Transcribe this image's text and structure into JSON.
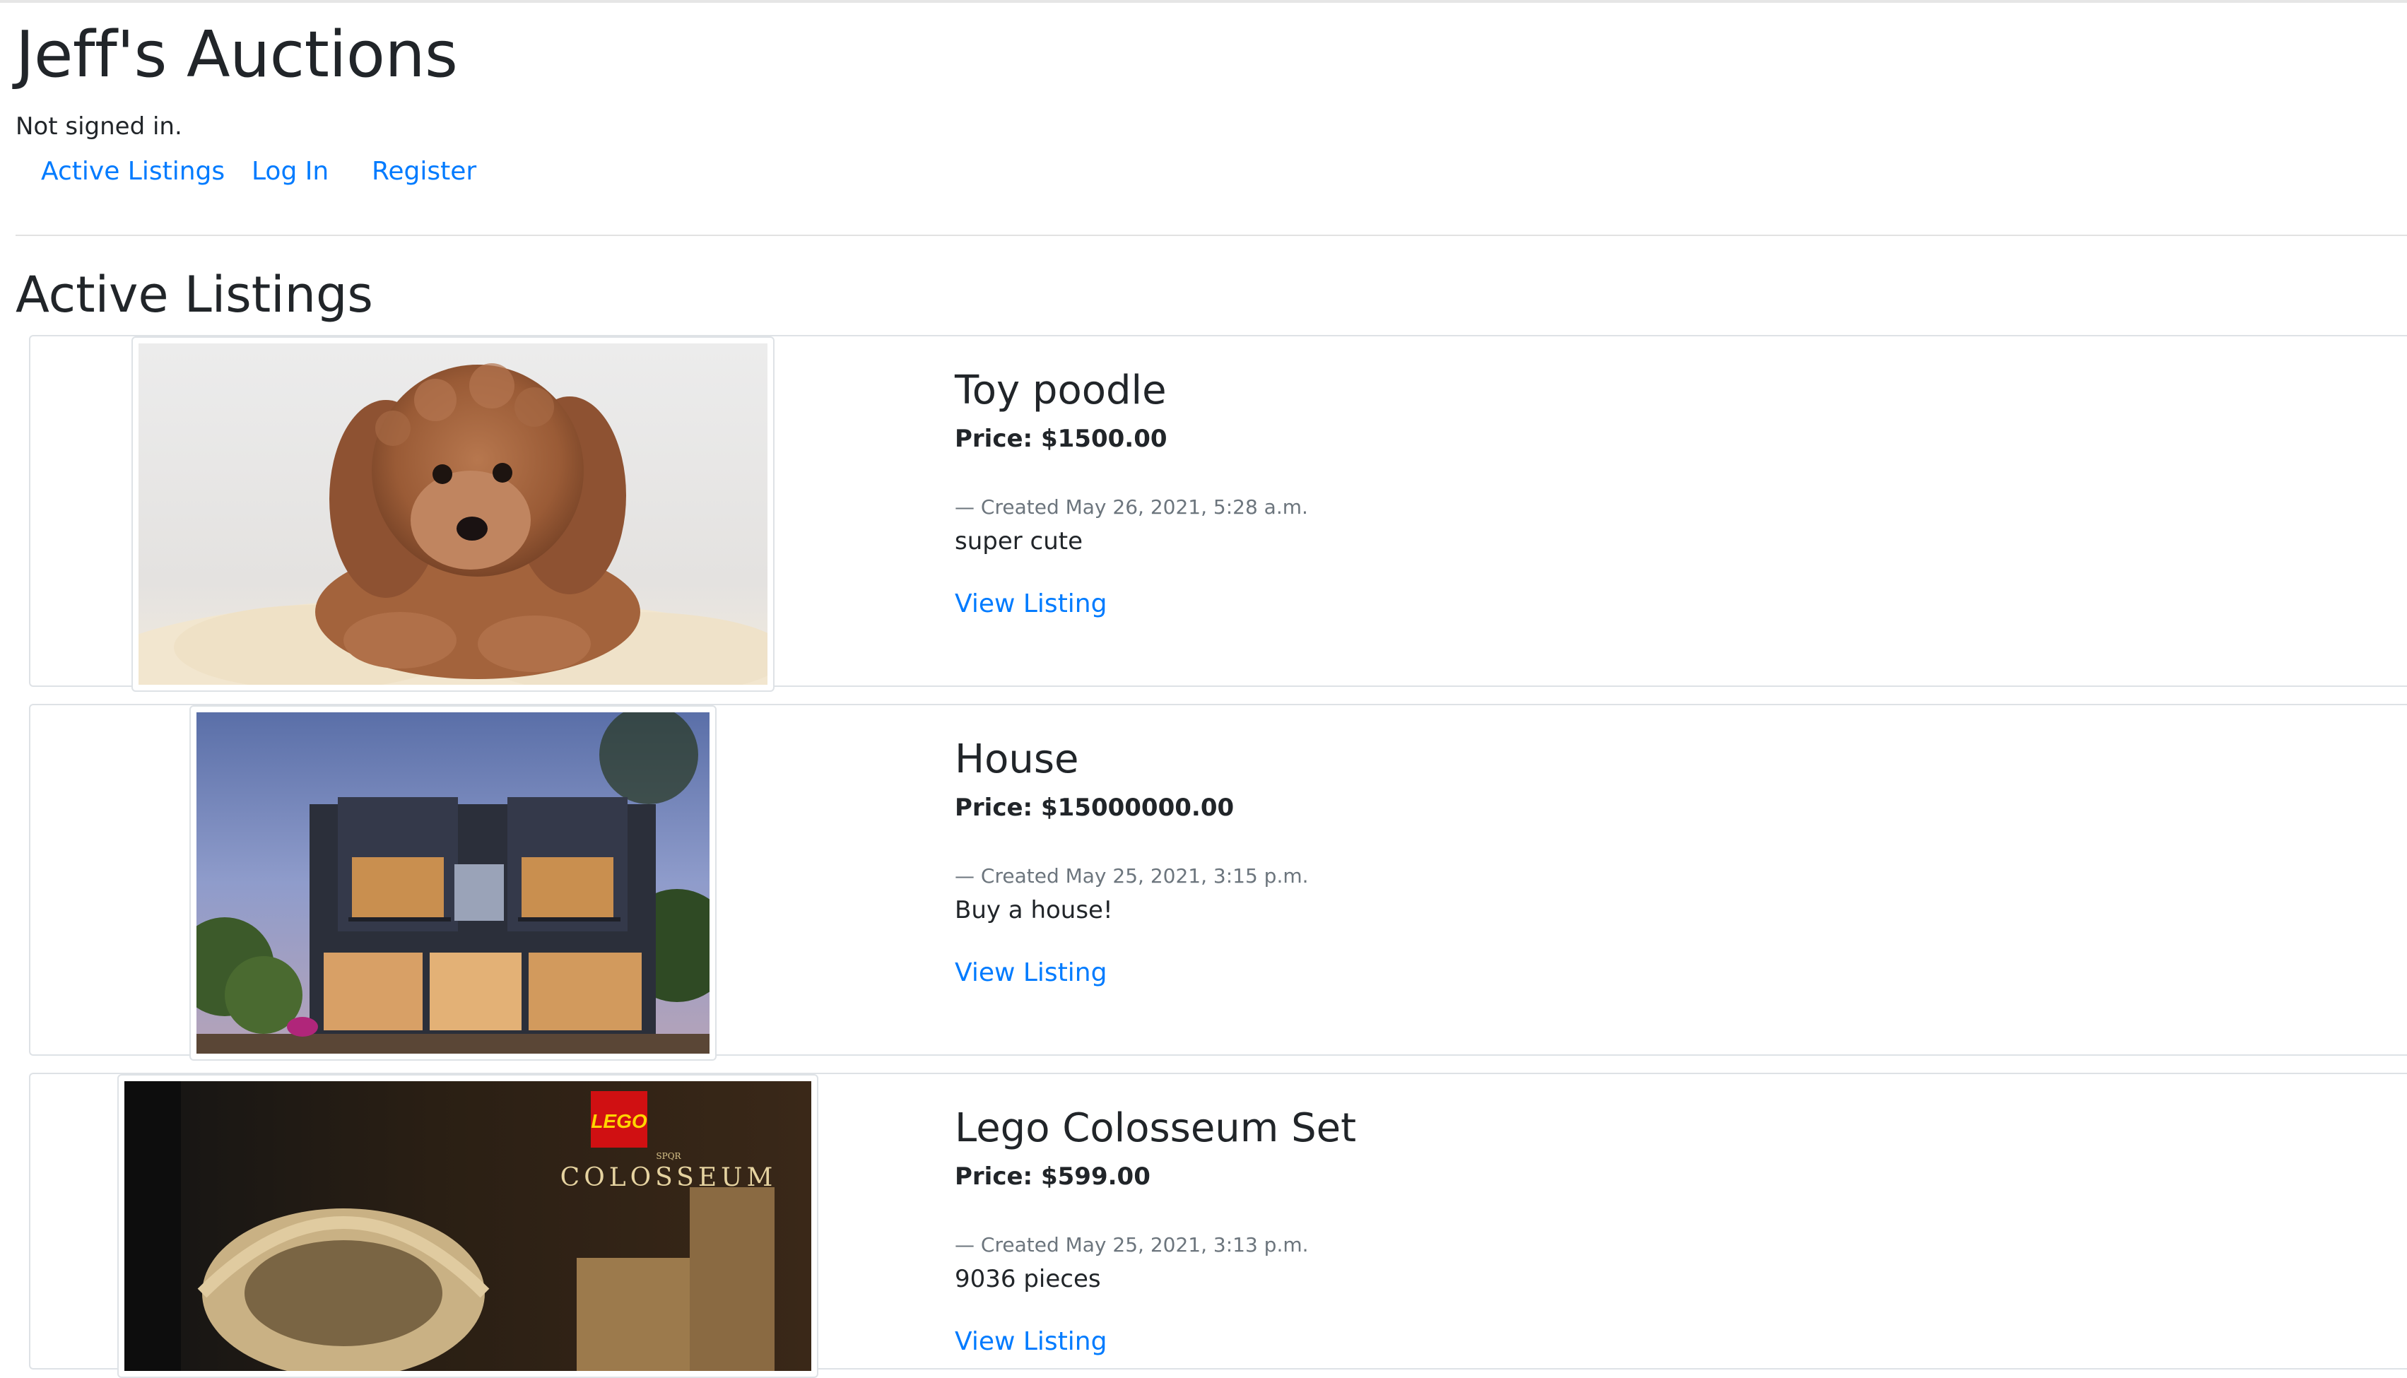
{
  "site": {
    "title": "Jeff's Auctions",
    "auth_status": "Not signed in."
  },
  "nav": {
    "items": [
      {
        "label": "Active Listings"
      },
      {
        "label": "Log In"
      },
      {
        "label": "Register"
      }
    ]
  },
  "main": {
    "section_title": "Active Listings",
    "listings": [
      {
        "title": "Toy poodle",
        "price": "Price: $1500.00",
        "created": "— Created May 26, 2021, 5:28 a.m.",
        "description": "super cute",
        "link_label": "View Listing"
      },
      {
        "title": "House",
        "price": "Price: $15000000.00",
        "created": "— Created May 25, 2021, 3:15 p.m.",
        "description": "Buy a house!",
        "link_label": "View Listing"
      },
      {
        "title": "Lego Colosseum Set",
        "price": "Price: $599.00",
        "created": "— Created May 25, 2021, 3:13 p.m.",
        "description": "9036 pieces",
        "link_label": "View Listing"
      }
    ],
    "images": {
      "lego_logo": "LEGO",
      "lego_box_text": "COLOSSEUM",
      "lego_box_small_text": "SPQR"
    }
  },
  "colors": {
    "link": "#007bff",
    "text": "#212529",
    "muted": "#6c757d",
    "border": "#dee2e6"
  }
}
